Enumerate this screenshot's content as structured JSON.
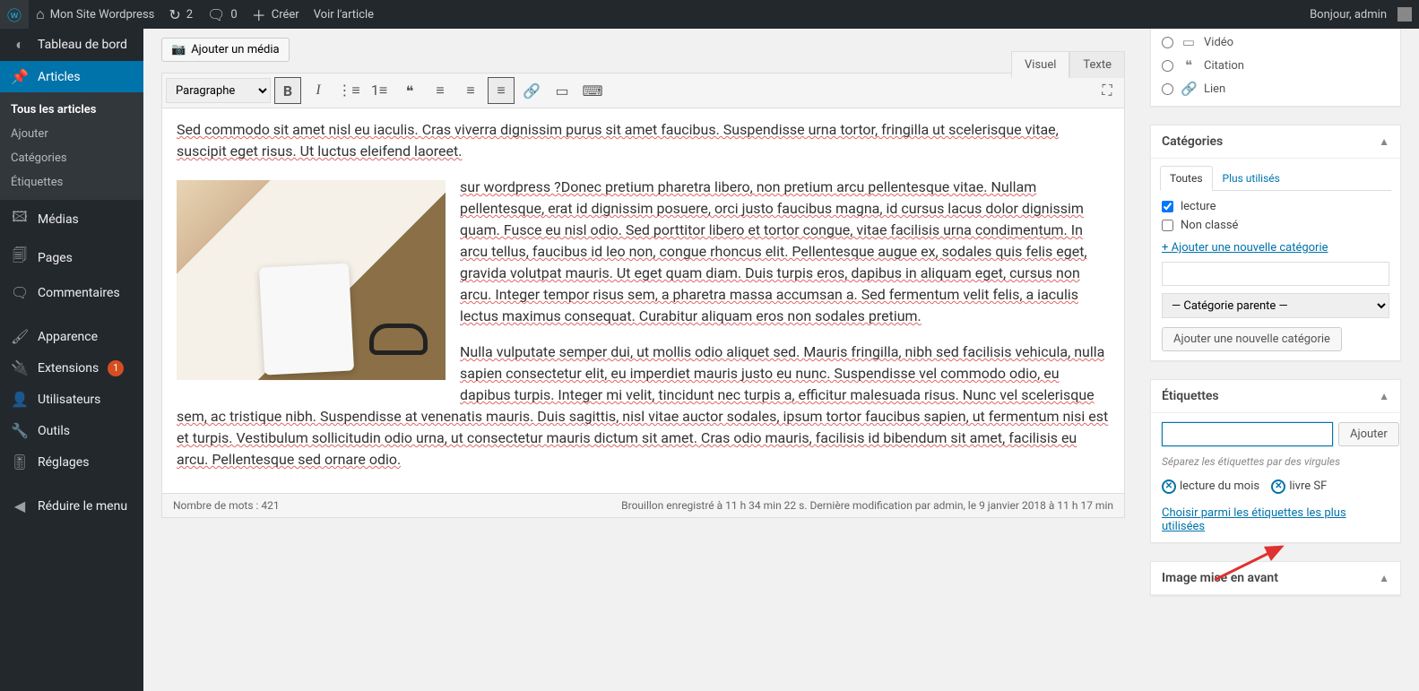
{
  "adminbar": {
    "site_name": "Mon Site Wordpress",
    "updates_count": "2",
    "comments_count": "0",
    "new_label": "Créer",
    "view_label": "Voir l'article",
    "greeting": "Bonjour, admin"
  },
  "sidebar": {
    "items": {
      "dashboard": "Tableau de bord",
      "posts": "Articles",
      "media": "Médias",
      "pages": "Pages",
      "comments": "Commentaires",
      "appearance": "Apparence",
      "plugins": "Extensions",
      "plugins_badge": "1",
      "users": "Utilisateurs",
      "tools": "Outils",
      "settings": "Réglages",
      "collapse": "Réduire le menu"
    },
    "posts_sub": {
      "all": "Tous les articles",
      "add": "Ajouter",
      "categories": "Catégories",
      "tags": "Étiquettes"
    }
  },
  "editor": {
    "add_media": "Ajouter un média",
    "tab_visual": "Visuel",
    "tab_text": "Texte",
    "format_select": "Paragraphe",
    "body_p1": "Sed commodo sit amet nisl eu iaculis. Cras viverra dignissim purus sit amet faucibus. Suspendisse urna tortor, fringilla ut scelerisque vitae, suscipit eget risus. Ut luctus eleifend laoreet.",
    "body_p2": "sur wordpress ?Donec pretium pharetra libero, non pretium arcu pellentesque vitae. Nullam pellentesque, erat id dignissim posuere, orci justo faucibus magna, id cursus lacus dolor dignissim quam. Fusce eu nisl odio. Sed porttitor libero et tortor congue, vitae facilisis urna condimentum. In arcu tellus, faucibus id leo non, congue rhoncus elit. Pellentesque augue ex, sodales quis felis eget, gravida volutpat mauris. Ut eget quam diam. Duis turpis eros, dapibus in aliquam eget, cursus non arcu. Integer tempor risus sem, a pharetra massa accumsan a. Sed fermentum velit felis, a iaculis lectus maximus consequat. Curabitur aliquam eros non sodales pretium.",
    "body_p3": "Nulla vulputate semper dui, ut mollis odio aliquet sed. Mauris fringilla, nibh sed facilisis vehicula, nulla sapien consectetur elit, eu imperdiet mauris justo eu nunc. Suspendisse vel commodo odio, eu dapibus turpis. Integer mi velit, tincidunt nec turpis a, efficitur malesuada risus. Nunc vel scelerisque sem, ac tristique nibh. Suspendisse at venenatis mauris. Duis sagittis, nisl vitae auctor sodales, ipsum tortor faucibus sapien, ut fermentum nisi est et turpis. Vestibulum sollicitudin odio urna, ut consectetur mauris dictum sit amet. Cras odio mauris, facilisis id bibendum sit amet, facilisis eu arcu. Pellentesque sed ornare odio.",
    "word_count": "Nombre de mots : 421",
    "status_line": "Brouillon enregistré à 11 h 34 min 22 s. Dernière modification par admin, le 9 janvier 2018 à 11 h 17 min"
  },
  "formats": {
    "video": "Vidéo",
    "quote": "Citation",
    "link": "Lien"
  },
  "categories": {
    "title": "Catégories",
    "tab_all": "Toutes",
    "tab_most": "Plus utilisés",
    "items": [
      {
        "label": "lecture",
        "checked": true
      },
      {
        "label": "Non classé",
        "checked": false
      }
    ],
    "add_link": "+ Ajouter une nouvelle catégorie",
    "parent_placeholder": "— Catégorie parente —",
    "add_button": "Ajouter une nouvelle catégorie"
  },
  "tags": {
    "title": "Étiquettes",
    "add_button": "Ajouter",
    "hint": "Séparez les étiquettes par des virgules",
    "chips": [
      "lecture du mois",
      "livre SF"
    ],
    "choose_link": "Choisir parmi les étiquettes les plus utilisées"
  },
  "featured": {
    "title": "Image mise en avant"
  }
}
